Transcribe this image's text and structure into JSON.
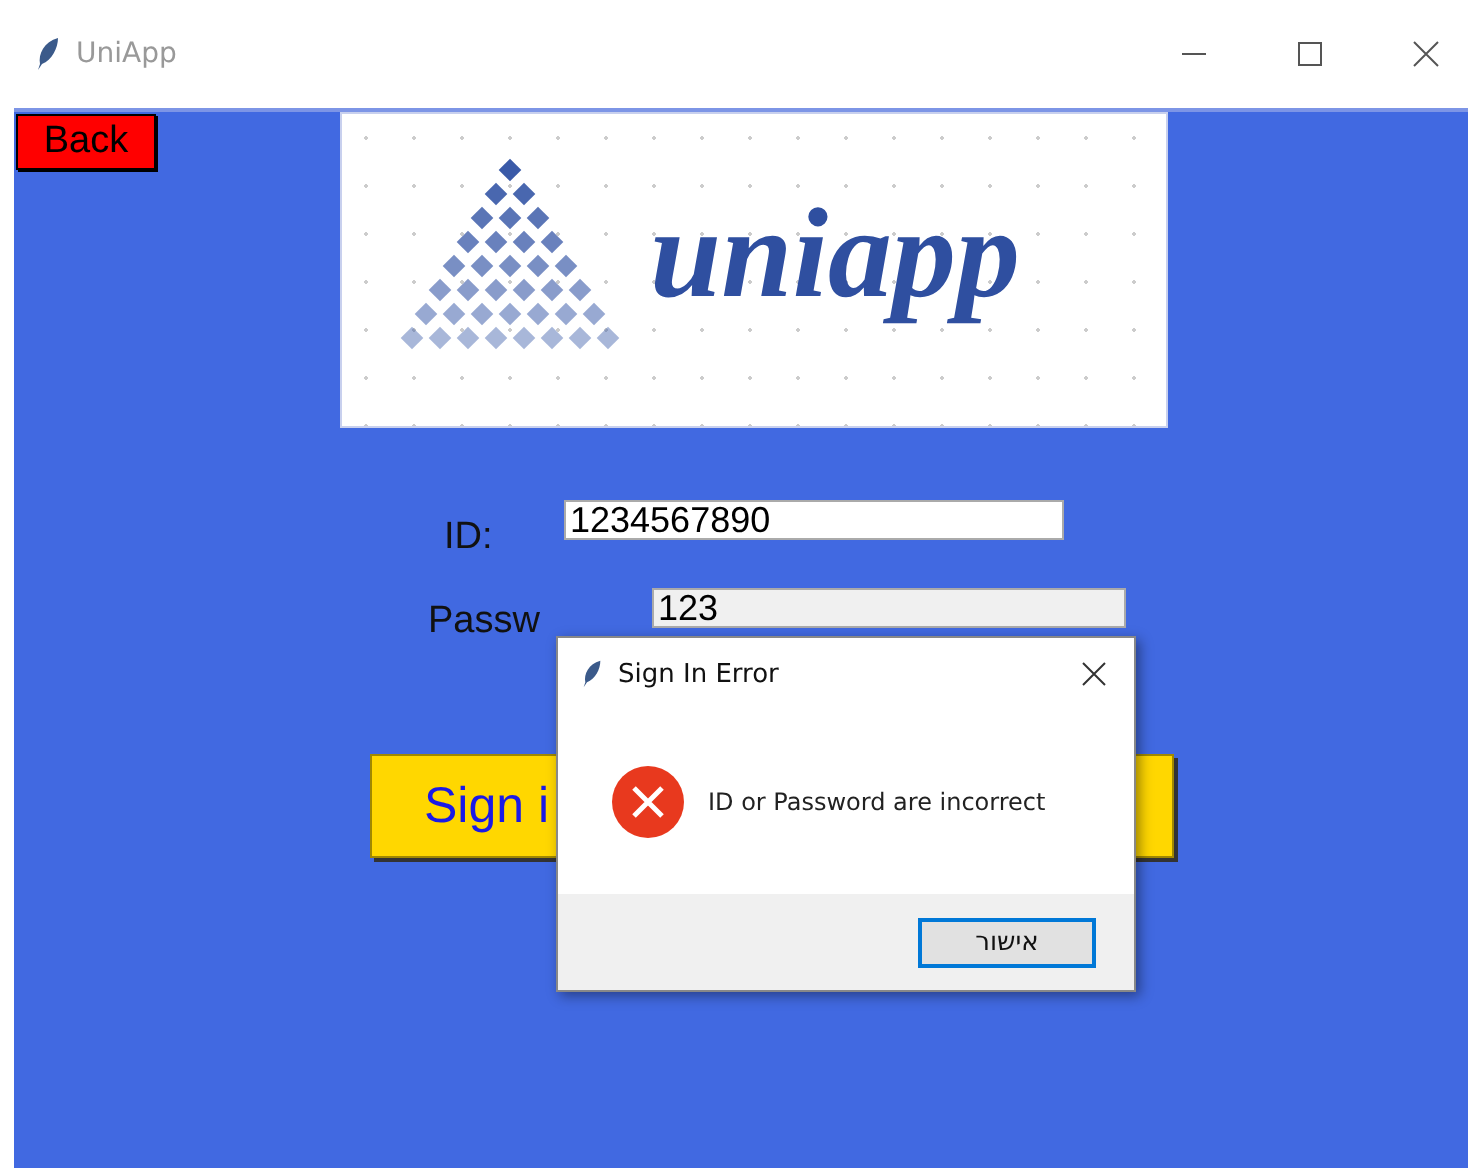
{
  "window": {
    "title": "UniApp"
  },
  "back_button": "Back",
  "logo": {
    "wordmark": "uniapp"
  },
  "fields": [
    {
      "kind": "id",
      "label": "ID:",
      "value": "1234567890"
    },
    {
      "kind": "password",
      "label": "Passw",
      "value": "123"
    }
  ],
  "sign_in_button": "Sign i",
  "dialog": {
    "title": "Sign In Error",
    "message": "ID or Password are incorrect",
    "buttons": [
      {
        "label": "אישור",
        "focused": true
      }
    ]
  }
}
